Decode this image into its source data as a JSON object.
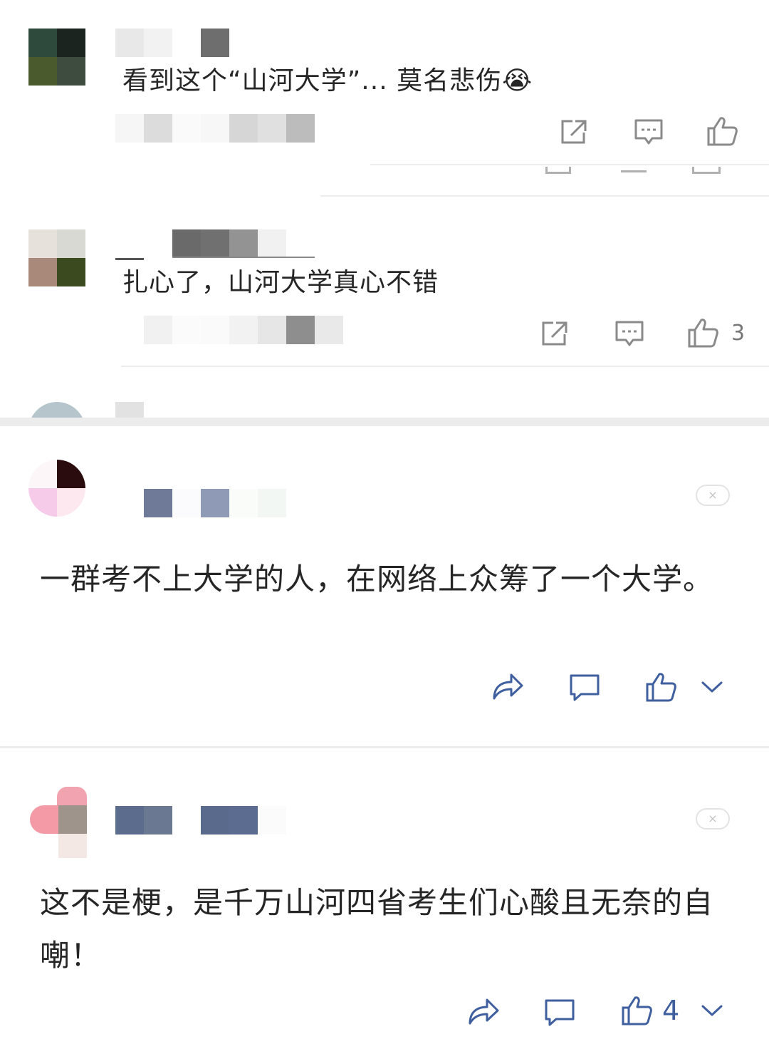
{
  "colors": {
    "icon_gray": "#8a8a8a",
    "icon_blue": "#3f5f9f",
    "text": "#262626",
    "count_gray": "#777777",
    "divider": "#ededed"
  },
  "top_comments": [
    {
      "text": "看到这个“山河大学”... 莫名悲伤😭",
      "like_count": ""
    },
    {
      "text": "扎心了，山河大学真心不错",
      "like_count": "3"
    }
  ],
  "bottom_comments": [
    {
      "text": "一群考不上大学的人，在网络上众筹了一个大学。",
      "like_count": ""
    },
    {
      "text": "这不是梗，是千万山河四省考生们心酸且无奈的自嘲！",
      "like_count": "4"
    }
  ],
  "icons": {
    "share": "share-external-icon",
    "comment": "comment-bubble-icon",
    "like": "thumbs-up-icon",
    "forward": "forward-arrow-icon",
    "more": "chevron-down-icon",
    "close": "close-icon"
  },
  "close_symbol": "×"
}
